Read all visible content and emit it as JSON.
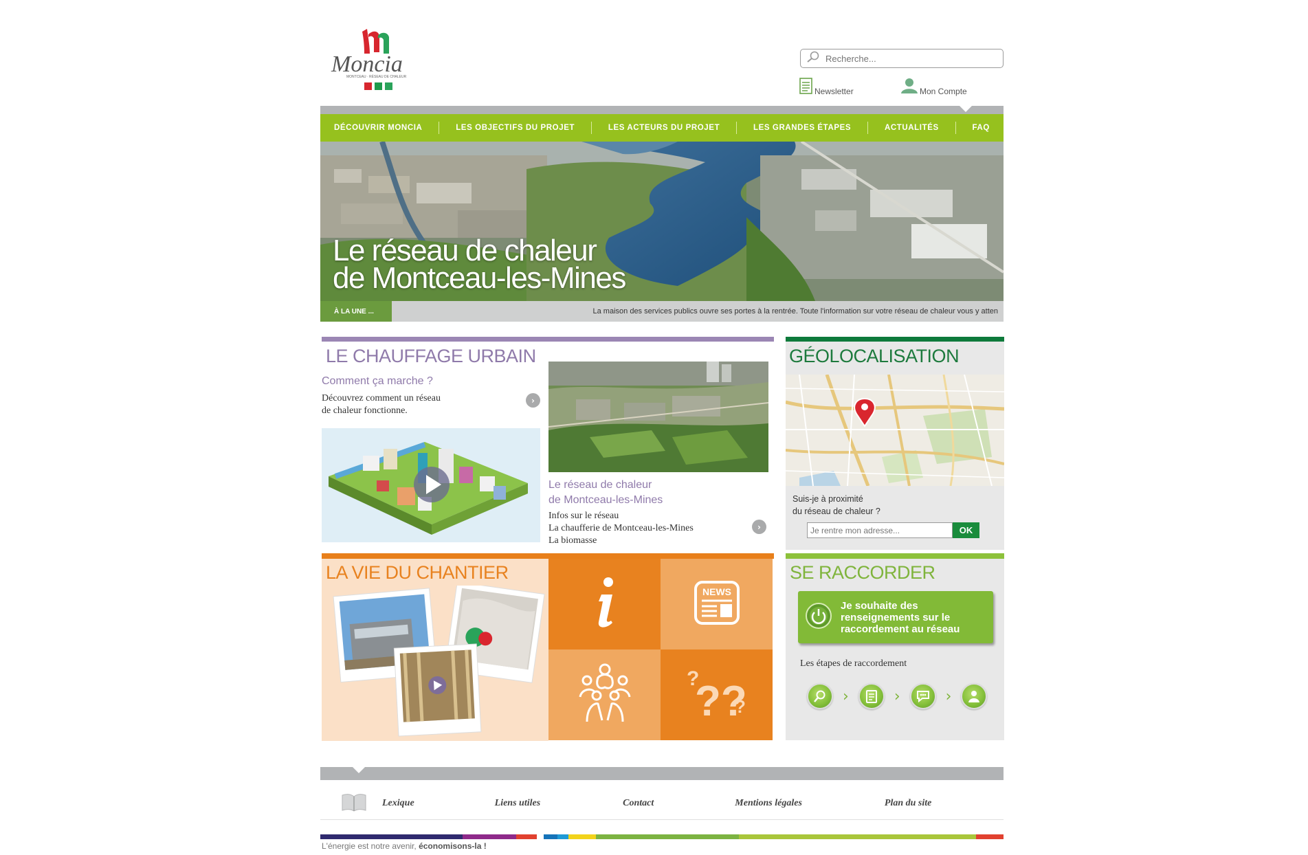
{
  "header": {
    "logo_text": "Moncia",
    "logo_tagline": "MONTCEAU · RÉSEAU DE CHALEUR",
    "search_placeholder": "Recherche...",
    "newsletter_label": "Newsletter",
    "account_label": "Mon Compte"
  },
  "nav": {
    "items": [
      {
        "label": "Découvrir Moncia"
      },
      {
        "label": "Les objectifs du projet"
      },
      {
        "label": "Les acteurs du projet"
      },
      {
        "label": "Les grandes étapes"
      },
      {
        "label": "Actualités"
      },
      {
        "label": "FAQ"
      }
    ]
  },
  "hero": {
    "title_line1": "Le réseau de chaleur",
    "title_line2": "de Montceau-les-Mines",
    "ticker_tag": "À LA UNE ...",
    "ticker_text": "La maison des services publics ouvre ses portes à la rentrée. Toute l'information sur votre réseau de chaleur vous y atten"
  },
  "chauffage": {
    "title": "LE CHAUFFAGE URBAIN",
    "how_title": "Comment ça marche ?",
    "how_text_line1": "Découvrez comment un réseau",
    "how_text_line2": "de chaleur fonctionne.",
    "network_title_line1": "Le réseau de chaleur",
    "network_title_line2": "de Montceau-les-Mines",
    "network_links": [
      "Infos sur le réseau",
      "La chaufferie de Montceau-les-Mines",
      "La biomasse"
    ]
  },
  "geo": {
    "title": "GÉOLOCALISATION",
    "question_line1": "Suis-je à proximité",
    "question_line2": "du réseau de chaleur ?",
    "address_placeholder": "Je rentre mon adresse...",
    "ok_label": "OK"
  },
  "chantier": {
    "title": "LA VIE DU CHANTIER",
    "tile_news_label": "NEWS"
  },
  "raccorder": {
    "title": "SE RACCORDER",
    "button_label": "Je souhaite des renseignements sur le raccordement au réseau",
    "steps_label": "Les étapes de raccordement"
  },
  "footer": {
    "links": [
      "Lexique",
      "Liens utiles",
      "Contact",
      "Mentions légales",
      "Plan du site"
    ],
    "slogan_normal": "L'énergie est notre avenir,",
    "slogan_bold": "économisons-la !"
  },
  "colors": {
    "nav_green": "#96c11e",
    "purple": "#9b86b4",
    "dark_green": "#0e7a3b",
    "orange": "#e8821f",
    "light_green": "#8dc13b"
  }
}
